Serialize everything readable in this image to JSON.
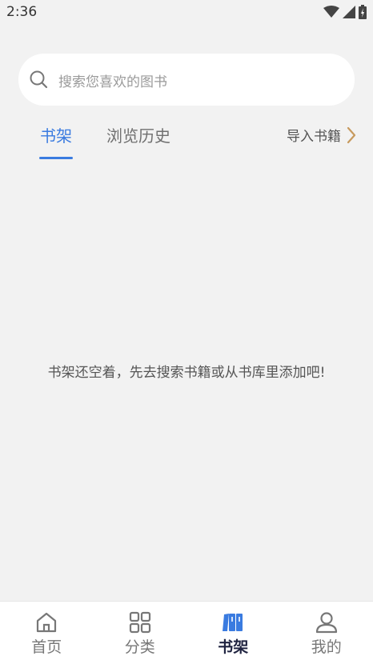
{
  "status": {
    "time": "2:36"
  },
  "search": {
    "placeholder": "搜索您喜欢的图书"
  },
  "tabs": [
    {
      "label": "书架",
      "active": true
    },
    {
      "label": "浏览历史",
      "active": false
    }
  ],
  "import": {
    "label": "导入书籍"
  },
  "empty_message": "书架还空着，先去搜索书籍或从书库里添加吧!",
  "nav": [
    {
      "label": "首页",
      "icon": "home-icon",
      "active": false
    },
    {
      "label": "分类",
      "icon": "grid-icon",
      "active": false
    },
    {
      "label": "书架",
      "icon": "bookshelf-icon",
      "active": true
    },
    {
      "label": "我的",
      "icon": "user-icon",
      "active": false
    }
  ],
  "colors": {
    "accent": "#3a7be0",
    "chevron": "#c79a5e",
    "active_nav": "#1f2340"
  }
}
